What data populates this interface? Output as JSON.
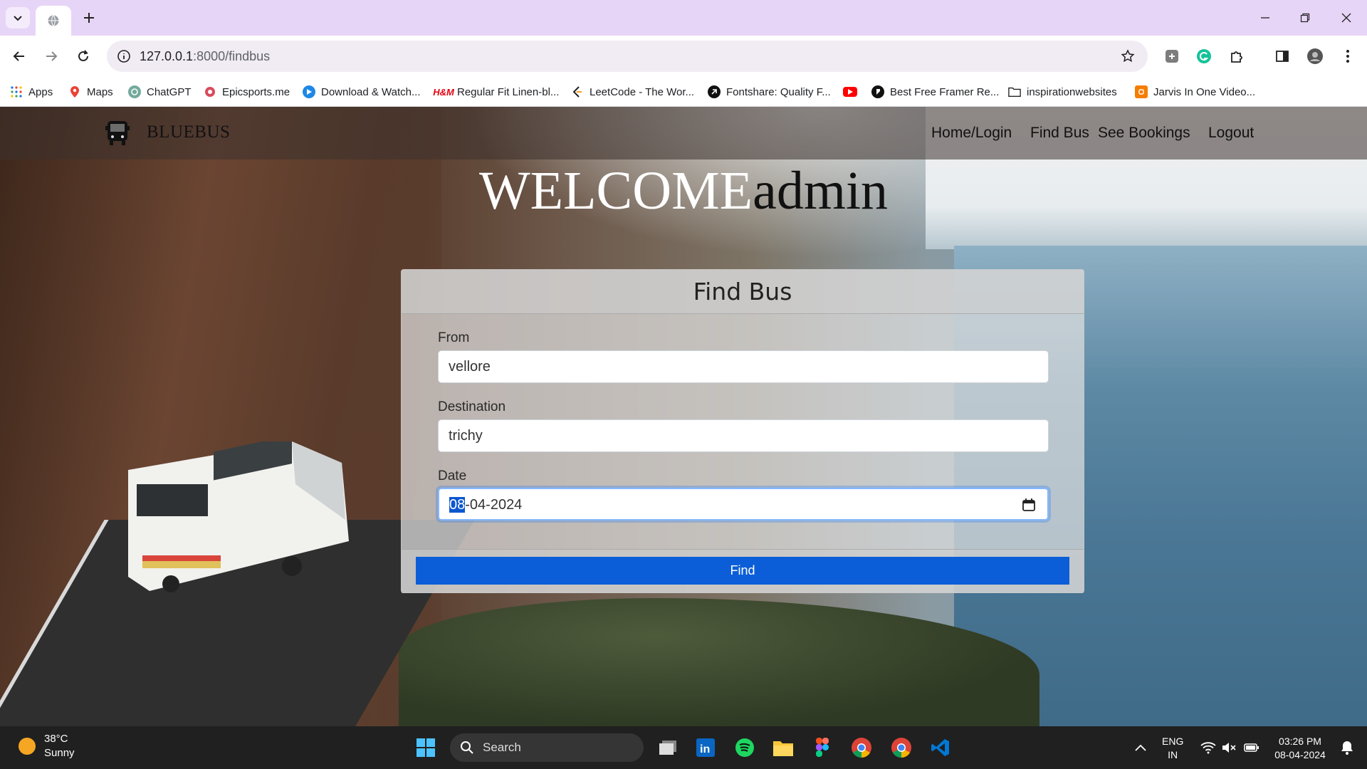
{
  "browser": {
    "address": {
      "host": "127.0.0.1",
      "path": ":8000/findbus"
    },
    "bookmarks": [
      {
        "label": "Apps",
        "icon": "apps-grid-icon"
      },
      {
        "label": "Maps",
        "icon": "maps-icon"
      },
      {
        "label": "ChatGPT",
        "icon": "chatgpt-icon"
      },
      {
        "label": "Epicsports.me",
        "icon": "epicsports-icon"
      },
      {
        "label": "Download & Watch...",
        "icon": "play-icon"
      },
      {
        "label": "Regular Fit Linen-bl...",
        "icon": "hm-icon"
      },
      {
        "label": "LeetCode - The Wor...",
        "icon": "leetcode-icon"
      },
      {
        "label": "Fontshare: Quality F...",
        "icon": "fontshare-icon"
      },
      {
        "label": "",
        "icon": "youtube-icon"
      },
      {
        "label": "Best Free Framer Re...",
        "icon": "framer-icon"
      },
      {
        "label": "inspirationwebsites",
        "icon": "folder-icon"
      },
      {
        "label": "Jarvis In One Video...",
        "icon": "blogger-icon"
      }
    ]
  },
  "site": {
    "brand": "BLUEBUS",
    "nav": [
      "Home/Login",
      "Find Bus",
      "See Bookings",
      "Logout"
    ],
    "welcome_prefix": "WELCOME",
    "username": "admin"
  },
  "form": {
    "title": "Find Bus",
    "from_label": "From",
    "from_value": "vellore",
    "destination_label": "Destination",
    "destination_value": "trichy",
    "date_label": "Date",
    "date_day": "08",
    "date_rest": "-04-2024",
    "submit_label": "Find"
  },
  "taskbar": {
    "temperature": "38°C",
    "condition": "Sunny",
    "search_label": "Search",
    "lang_top": "ENG",
    "lang_bottom": "IN",
    "time": "03:26 PM",
    "date": "08-04-2024"
  },
  "colors": {
    "accent": "#0b5ed7",
    "tabbar": "#e7d5f7"
  }
}
